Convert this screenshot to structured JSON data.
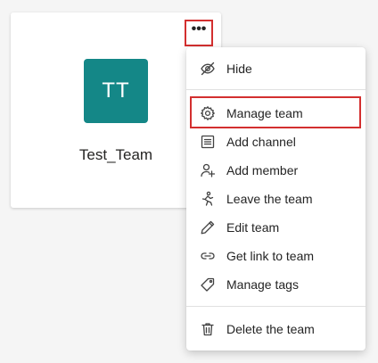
{
  "team": {
    "initials": "TT",
    "name": "Test_Team",
    "avatar_color": "#148787"
  },
  "more_button": {
    "glyph": "•••",
    "icon": "more-horizontal-icon"
  },
  "highlight_color": "#d32f2f",
  "menu": {
    "items": [
      {
        "label": "Hide",
        "icon": "eye-off-icon"
      },
      {
        "label": "Manage team",
        "icon": "gear-icon"
      },
      {
        "label": "Add channel",
        "icon": "channel-icon"
      },
      {
        "label": "Add member",
        "icon": "add-person-icon"
      },
      {
        "label": "Leave the team",
        "icon": "leave-icon"
      },
      {
        "label": "Edit team",
        "icon": "pencil-icon"
      },
      {
        "label": "Get link to team",
        "icon": "link-icon"
      },
      {
        "label": "Manage tags",
        "icon": "tag-icon"
      },
      {
        "label": "Delete the team",
        "icon": "trash-icon"
      }
    ]
  }
}
